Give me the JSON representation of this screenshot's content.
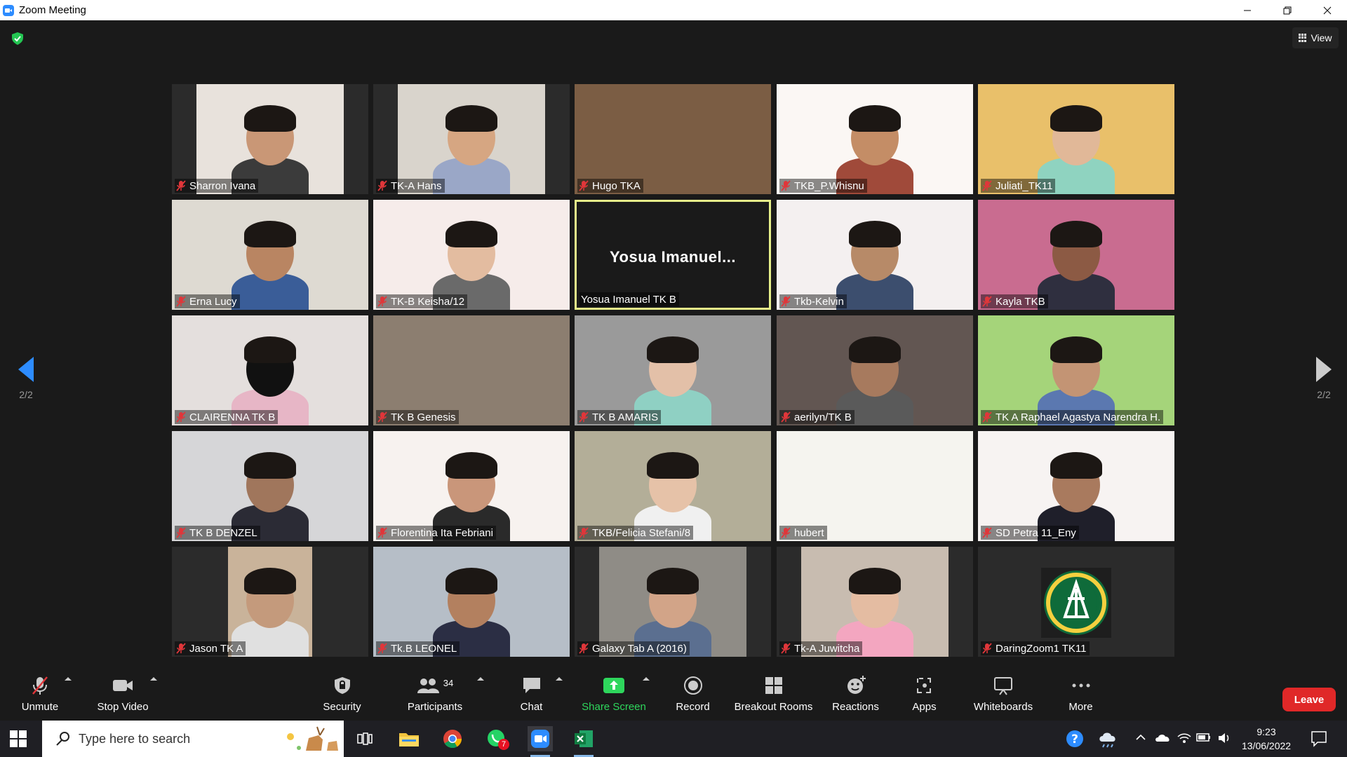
{
  "window": {
    "title": "Zoom Meeting",
    "controls": [
      "minimize",
      "restore",
      "close"
    ]
  },
  "meeting": {
    "view_label": "View",
    "page_indicator_left": "2/2",
    "page_indicator_right": "2/2",
    "active_speaker_display": "Yosua  Imanuel...",
    "participants": [
      {
        "name": "Sharron Ivana",
        "muted": true
      },
      {
        "name": "TK-A Hans",
        "muted": true
      },
      {
        "name": "Hugo TKA",
        "muted": true
      },
      {
        "name": "TKB_P.Whisnu",
        "muted": true
      },
      {
        "name": "Juliati_TK11",
        "muted": true
      },
      {
        "name": "Erna Lucy",
        "muted": true
      },
      {
        "name": "TK-B Keisha/12",
        "muted": true
      },
      {
        "name": "Yosua Imanuel TK B",
        "muted": false
      },
      {
        "name": "Tkb-Kelvin",
        "muted": true
      },
      {
        "name": "Kayla TKB",
        "muted": true
      },
      {
        "name": "CLAIRENNA TK B",
        "muted": true
      },
      {
        "name": "TK B Genesis",
        "muted": true
      },
      {
        "name": "TK B AMARIS",
        "muted": true
      },
      {
        "name": "aerilyn/TK B",
        "muted": true
      },
      {
        "name": "TK A Raphael Agastya Narendra H.",
        "muted": true
      },
      {
        "name": "TK B DENZEL",
        "muted": true
      },
      {
        "name": "Florentina Ita Febriani",
        "muted": true
      },
      {
        "name": "TKB/Felicia Stefani/8",
        "muted": true
      },
      {
        "name": "hubert",
        "muted": true
      },
      {
        "name": "SD Petra 11_Eny",
        "muted": true
      },
      {
        "name": "Jason TK A",
        "muted": true
      },
      {
        "name": "Tk.B LEONEL",
        "muted": true
      },
      {
        "name": "Galaxy Tab A (2016)",
        "muted": true
      },
      {
        "name": "Tk-A Juwitcha",
        "muted": true
      },
      {
        "name": "DaringZoom1 TK11",
        "muted": true
      }
    ]
  },
  "toolbar": {
    "unmute": "Unmute",
    "stop_video": "Stop Video",
    "security": "Security",
    "participants": "Participants",
    "participants_count": "34",
    "chat": "Chat",
    "share_screen": "Share Screen",
    "record": "Record",
    "breakout_rooms": "Breakout Rooms",
    "reactions": "Reactions",
    "apps": "Apps",
    "whiteboards": "Whiteboards",
    "more": "More",
    "leave": "Leave"
  },
  "taskbar": {
    "search_placeholder": "Type here to search",
    "time": "9:23",
    "date": "13/06/2022",
    "whatsapp_badge": "7",
    "apps": [
      "task-view-icon",
      "file-explorer-icon",
      "chrome-icon",
      "whatsapp-icon",
      "zoom-icon",
      "excel-icon"
    ]
  },
  "colors": {
    "accent_blue": "#2d8cff",
    "share_green": "#2ed65c",
    "leave_red": "#e02828",
    "mute_red": "#e0363a",
    "active_border": "#e6f08a"
  }
}
